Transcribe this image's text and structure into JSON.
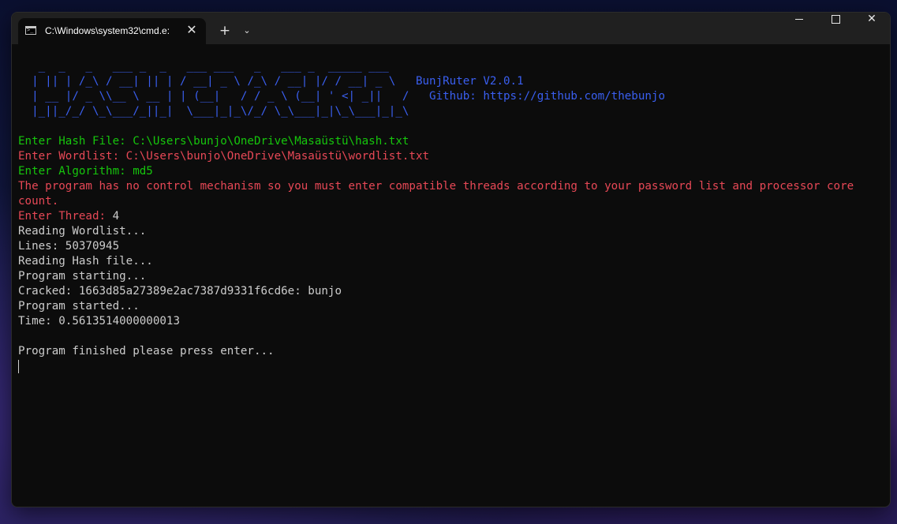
{
  "window": {
    "tab_title": "C:\\Windows\\system32\\cmd.e:",
    "tab_close": "✕",
    "new_tab": "+",
    "dropdown": "⌄",
    "close": "✕"
  },
  "terminal": {
    "banner": [
      "",
      "   _  _   _   ___ _  _   ___ ___   _   ___ _  _____ ___",
      "  | || | /_\\ / __| || | / __| _ \\ /_\\ / __| |/ / __| _ \\   BunjRuter V2.0.1",
      "  | __ |/ _ \\\\__ \\ __ | | (__|   / / _ \\ (__| ' <| _||   /   Github: https://github.com/thebunjo",
      "  |_||_/_/ \\_\\___/_||_|  \\___|_|_\\/_/ \\_\\___|_|\\_\\___|_|_\\"
    ],
    "hash_prompt": "Enter Hash File: ",
    "hash_value": "C:\\Users\\bunjo\\OneDrive\\Masaüstü\\hash.txt",
    "wordlist_prompt": "Enter Wordlist: ",
    "wordlist_value": "C:\\Users\\bunjo\\OneDrive\\Masaüstü\\wordlist.txt",
    "algorithm_prompt": "Enter Algorithm: ",
    "algorithm_value": "md5",
    "warning": "The program has no control mechanism so you must enter compatible threads according to your password list and processor core count.",
    "thread_prompt": "Enter Thread: ",
    "thread_value": "4",
    "output": [
      "Reading Wordlist...",
      "Lines: 50370945",
      "Reading Hash file...",
      "Program starting...",
      "Cracked: 1663d85a27389e2ac7387d9331f6cd6e: bunjo",
      "Program started...",
      "Time: 0.5613514000000013",
      "",
      "Program finished please press enter..."
    ]
  },
  "colors": {
    "banner": "#3a5ff0",
    "green": "#16c60c",
    "red": "#e74856",
    "text": "#cccccc"
  }
}
